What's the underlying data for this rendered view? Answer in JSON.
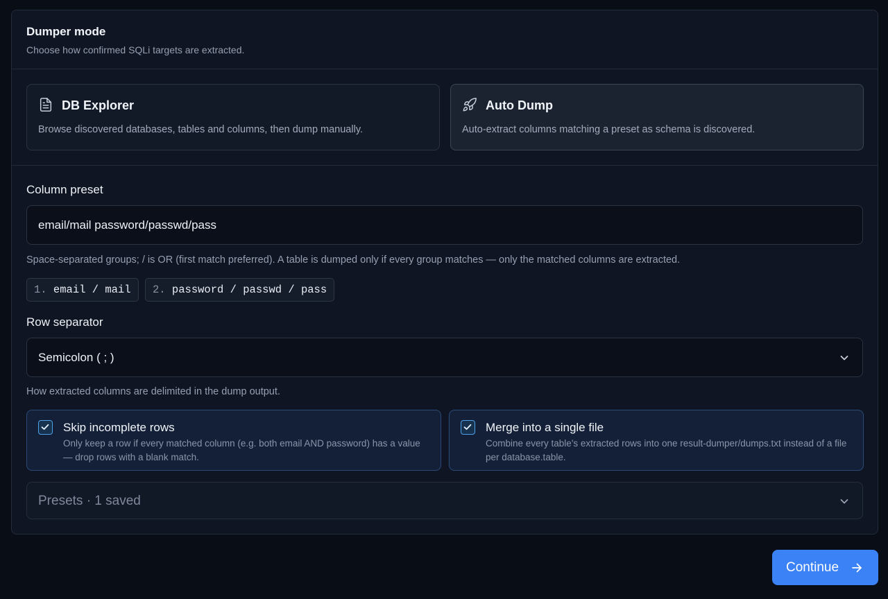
{
  "dumper_mode": {
    "title": "Dumper mode",
    "subtitle": "Choose how confirmed SQLi targets are extracted.",
    "modes": [
      {
        "icon": "document-icon",
        "title": "DB Explorer",
        "description": "Browse discovered databases, tables and columns, then dump manually.",
        "selected": false
      },
      {
        "icon": "rocket-icon",
        "title": "Auto Dump",
        "description": "Auto-extract columns matching a preset as schema is discovered.",
        "selected": true
      }
    ]
  },
  "column_preset": {
    "label": "Column preset",
    "value": "email/mail password/passwd/pass",
    "help": "Space-separated groups; / is OR (first match preferred). A table is dumped only if every group matches — only the matched columns are extracted.",
    "groups": [
      {
        "num": "1.",
        "text": "email / mail"
      },
      {
        "num": "2.",
        "text": "password / passwd / pass"
      }
    ]
  },
  "row_separator": {
    "label": "Row separator",
    "selected": "Semicolon ( ; )",
    "help": "How extracted columns are delimited in the dump output."
  },
  "options": [
    {
      "title": "Skip incomplete rows",
      "description": "Only keep a row if every matched column (e.g. both email AND password) has a value — drop rows with a blank match.",
      "checked": true
    },
    {
      "title": "Merge into a single file",
      "description": "Combine every table's extracted rows into one result-dumper/dumps.txt instead of a file per database.table.",
      "checked": true
    }
  ],
  "presets": {
    "label": "Presets · 1 saved"
  },
  "continue_button": {
    "label": "Continue"
  },
  "colors": {
    "background": "#090d16",
    "panel": "#0f1522",
    "accent": "#3b82f6",
    "checkbox": "#4ea2e8"
  }
}
